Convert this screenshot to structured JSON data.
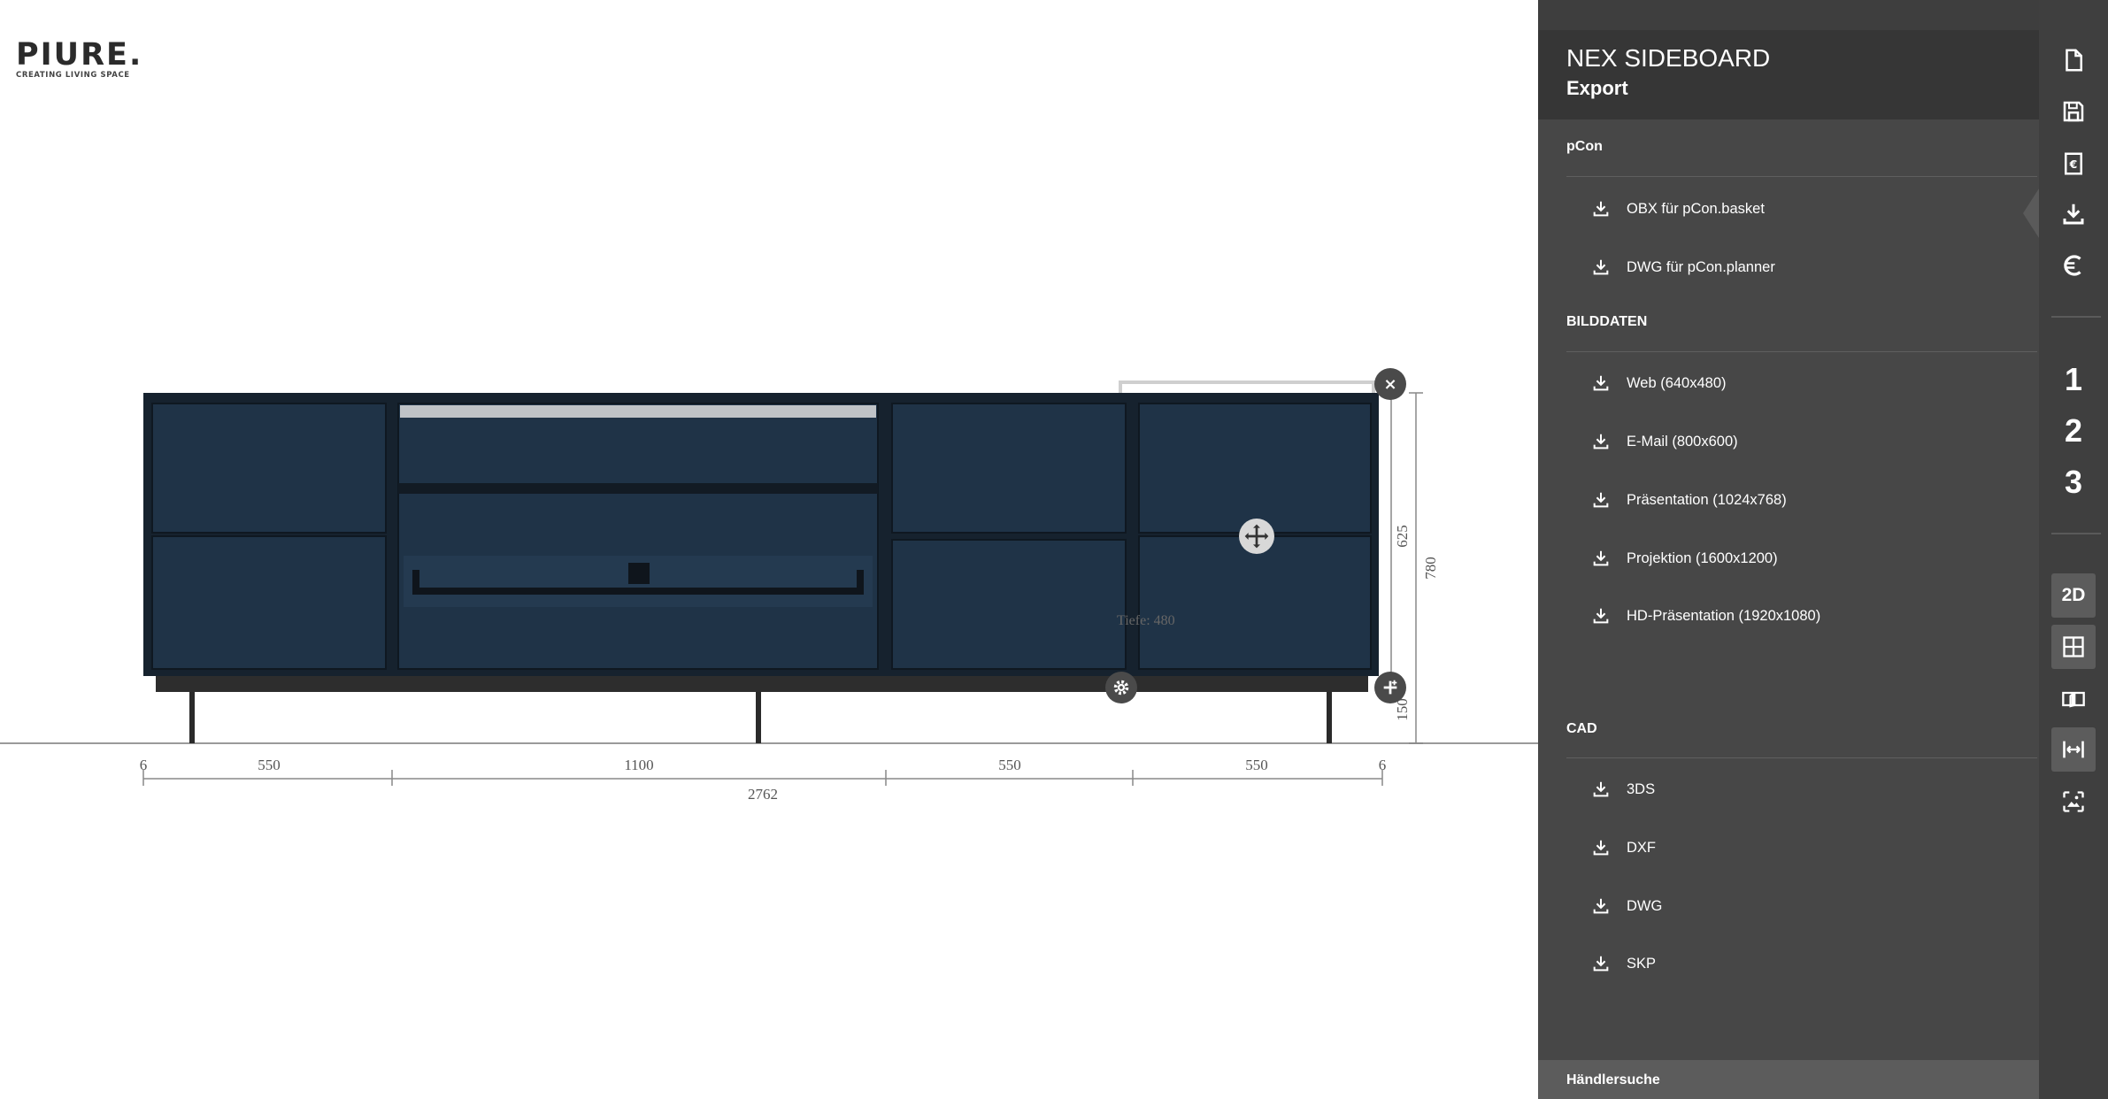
{
  "brand": {
    "name": "PIURE.",
    "tagline": "CREATING LIVING SPACE"
  },
  "drawing": {
    "width_labels": [
      "6",
      "550",
      "1100",
      "550",
      "550",
      "6"
    ],
    "total_width": "2762",
    "height_body": "625",
    "height_total": "780",
    "height_legs": "150",
    "depth_label": "Tiefe: 480",
    "colors": {
      "front": "#1f3347",
      "frame": "#16222e",
      "plinth": "#2d2d2d"
    }
  },
  "controls": {
    "close_glyph": "×"
  },
  "panel": {
    "title": "NEX SIDEBOARD",
    "subtitle": "Export",
    "sections": [
      {
        "heading": "pCon",
        "items": [
          "OBX für pCon.basket",
          "DWG für pCon.planner"
        ]
      },
      {
        "heading": "BILDDATEN",
        "items": [
          "Web (640x480)",
          "E-Mail (800x600)",
          "Präsentation (1024x768)",
          "Projektion (1600x1200)",
          "HD-Präsentation (1920x1080)"
        ]
      },
      {
        "heading": "CAD",
        "items": [
          "3DS",
          "DXF",
          "DWG",
          "SKP"
        ]
      }
    ],
    "footer": "Händlersuche",
    "colors": {
      "panel": "#474747",
      "header": "#363636",
      "iconbar": "#3f3f3f"
    }
  },
  "iconbar": {
    "icons": [
      "new-file-icon",
      "save-icon",
      "price-icon",
      "download-icon",
      "currency-icon"
    ],
    "numbers": [
      "1",
      "2",
      "3"
    ],
    "view_label": "2D",
    "active_icon": "download-icon"
  }
}
